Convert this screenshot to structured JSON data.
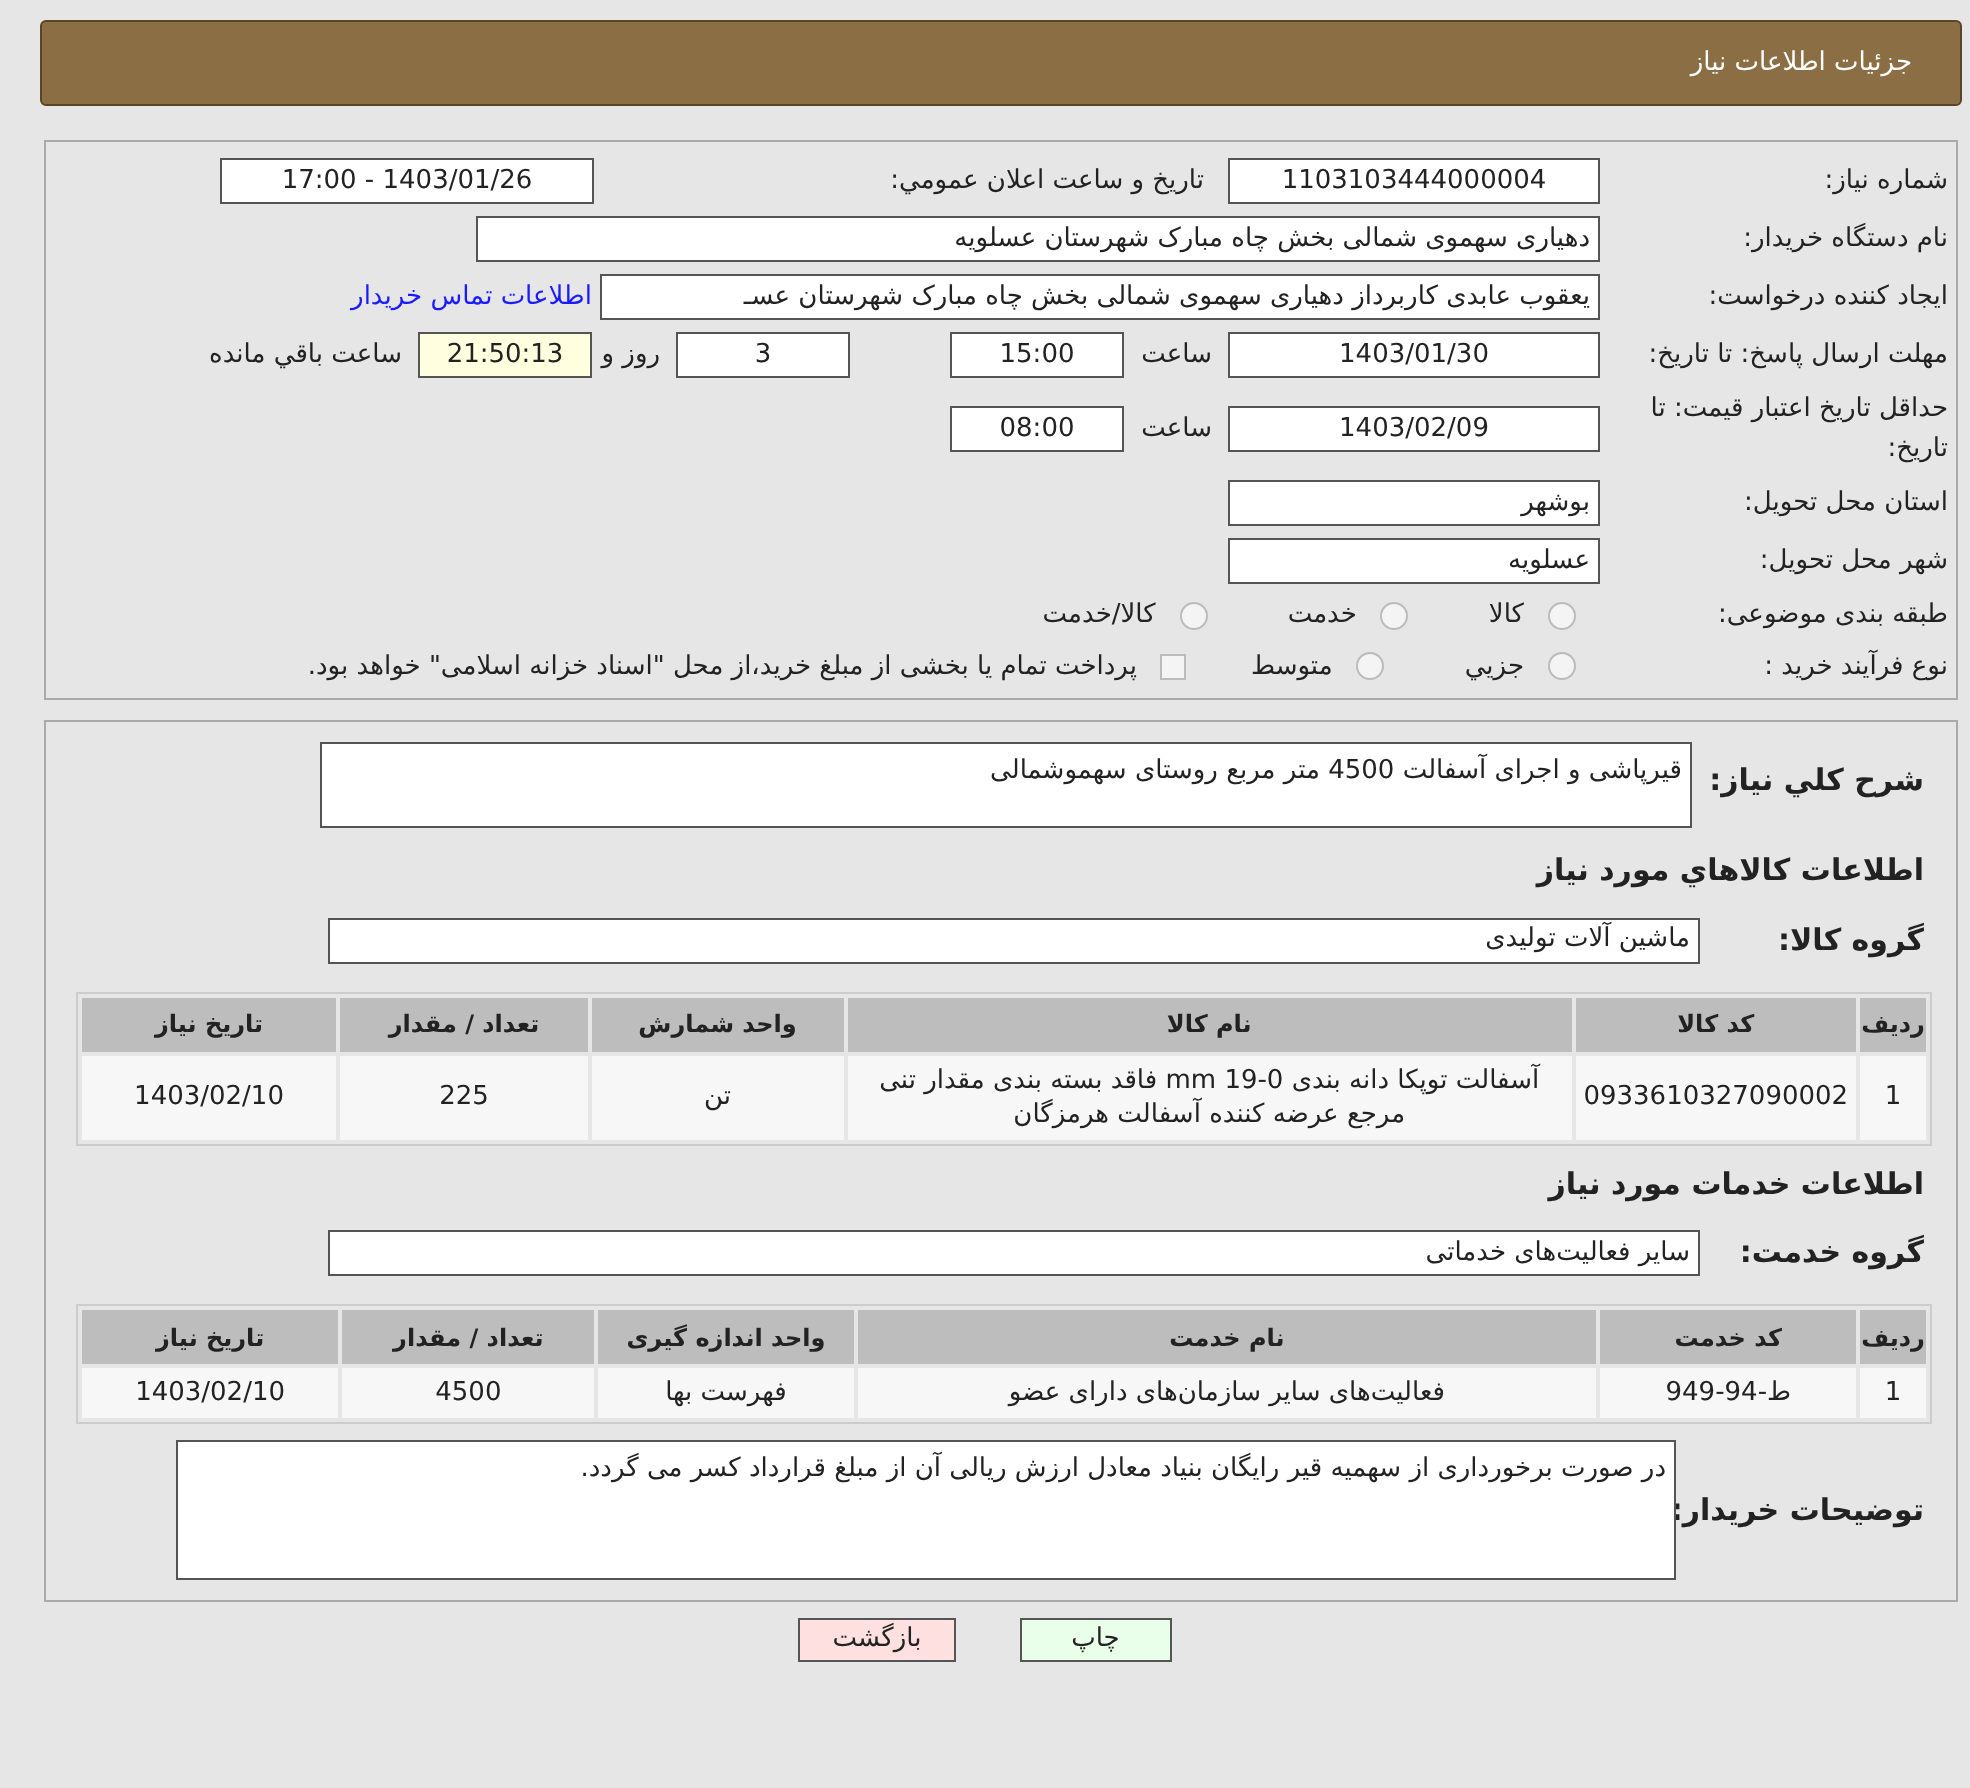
{
  "header": {
    "title": "جزئیات اطلاعات نیاز"
  },
  "need_number": {
    "label": "شماره نیاز:",
    "value": "1103103444000004"
  },
  "announce": {
    "label": "تاریخ و ساعت اعلان عمومي:",
    "value": "1403/01/26 - 17:00"
  },
  "buyer_org": {
    "label": "نام دستگاه خریدار:",
    "value": "دهیاری سهموی شمالی بخش چاه مبارک شهرستان عسلویه"
  },
  "requester": {
    "label": "ایجاد کننده درخواست:",
    "value": "یعقوب عابدی کاربرداز دهیاری سهموی شمالی بخش چاه مبارک شهرستان عسـ",
    "link": "اطلاعات تماس خریدار"
  },
  "deadline": {
    "label": "مهلت ارسال پاسخ: تا تاریخ:",
    "date": "1403/01/30",
    "time_label": "ساعت",
    "time": "15:00",
    "days": "3",
    "days_label": "روز و",
    "remaining": "21:50:13",
    "remaining_label": "ساعت باقي مانده"
  },
  "validity": {
    "label": "حداقل تاریخ اعتبار قیمت: تا تاریخ:",
    "date": "1403/02/09",
    "time_label": "ساعت",
    "time": "08:00"
  },
  "province": {
    "label": "استان محل تحویل:",
    "value": "بوشهر"
  },
  "city": {
    "label": "شهر محل تحویل:",
    "value": "عسلویه"
  },
  "category": {
    "label": "طبقه بندی موضوعی:",
    "options": [
      {
        "label": "کالا",
        "selected": false
      },
      {
        "label": "خدمت",
        "selected": false
      },
      {
        "label": "کالا/خدمت",
        "selected": false
      }
    ]
  },
  "process": {
    "label": "نوع فرآیند خرید :",
    "options": [
      {
        "label": "جزيي",
        "selected": false
      },
      {
        "label": "متوسط",
        "selected": false
      }
    ],
    "payment": {
      "label": "پرداخت تمام یا بخشی از مبلغ خرید،از محل \"اسناد خزانه اسلامی\" خواهد بود.",
      "checked": false
    }
  },
  "description": {
    "label": "شرح کلي نیاز:",
    "value": "قیرپاشی و اجرای آسفالت 4500 متر مربع روستای سهموشمالی"
  },
  "goods": {
    "heading": "اطلاعات کالاهاي مورد نیاز",
    "group_label": "گروه کالا:",
    "group": "ماشین آلات تولیدی",
    "columns": [
      "ردیف",
      "کد کالا",
      "نام کالا",
      "واحد شمارش",
      "تعداد / مقدار",
      "تاریخ نیاز"
    ],
    "rows": [
      [
        "1",
        "0933610327090002",
        "آسفالت توپکا دانه بندی mm 19-0 فاقد بسته بندی مقدار تنی مرجع عرضه کننده آسفالت هرمزگان",
        "تن",
        "225",
        "1403/02/10"
      ]
    ]
  },
  "services": {
    "heading": "اطلاعات خدمات مورد نیاز",
    "group_label": "گروه خدمت:",
    "group": "سایر فعالیت‌های خدماتی",
    "columns": [
      "ردیف",
      "کد خدمت",
      "نام خدمت",
      "واحد اندازه گیری",
      "تعداد / مقدار",
      "تاریخ نیاز"
    ],
    "rows": [
      [
        "1",
        "ط-94-949",
        "فعالیت‌های سایر سازمان‌های دارای عضو",
        "فهرست بها",
        "4500",
        "1403/02/10"
      ]
    ]
  },
  "buyer_notes": {
    "label": "توضیحات خریدار:",
    "value": "در صورت برخورداری از سهمیه قیر رایگان بنیاد معادل ارزش ریالی آن از مبلغ قرارداد کسر می گردد."
  },
  "buttons": [
    {
      "label": "چاپ",
      "kind": "print"
    },
    {
      "label": "بازگشت",
      "kind": "back"
    }
  ]
}
